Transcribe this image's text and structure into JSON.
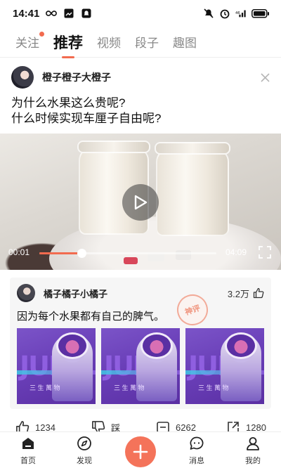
{
  "status_bar": {
    "time": "14:41",
    "left_icons": [
      "infinity-icon",
      "image-icon",
      "notification-app-icon"
    ],
    "right_icons": [
      "mute-icon",
      "alarm-icon",
      "signal-icon",
      "battery-icon"
    ]
  },
  "tabs": [
    {
      "label": "关注",
      "has_dot": true
    },
    {
      "label": "推荐",
      "active": true
    },
    {
      "label": "视频"
    },
    {
      "label": "段子"
    },
    {
      "label": "趣图"
    }
  ],
  "post": {
    "author": "橙子橙子大橙子",
    "text_line1": "为什么水果这么贵呢?",
    "text_line2": "什么时候实现车厘子自由呢?",
    "video": {
      "current_time": "00:01",
      "duration": "04:09",
      "progress": 0.24
    }
  },
  "comment_card": {
    "author": "橘子橘子小橘子",
    "likes": "3.2万",
    "text": "因为每个水果都有自己的脾气。",
    "stamp": "神评",
    "thumbnails": [
      {
        "big_text": "JUL",
        "caption": "三 生 萬 物"
      },
      {
        "big_text": "JUL",
        "caption": "三 生 萬 物"
      },
      {
        "big_text": "JUL",
        "caption": "三 生 萬 物"
      }
    ]
  },
  "actions": {
    "like_count": "1234",
    "dislike_label": "踩",
    "comment_count": "6262",
    "share_count": "1280"
  },
  "bottom_nav": {
    "home": "首页",
    "discover": "发现",
    "messages": "消息",
    "mine": "我的"
  },
  "colors": {
    "accent": "#f26b4f",
    "add_button": "#f4735a",
    "thumb_purple": "#6a3fb8"
  }
}
